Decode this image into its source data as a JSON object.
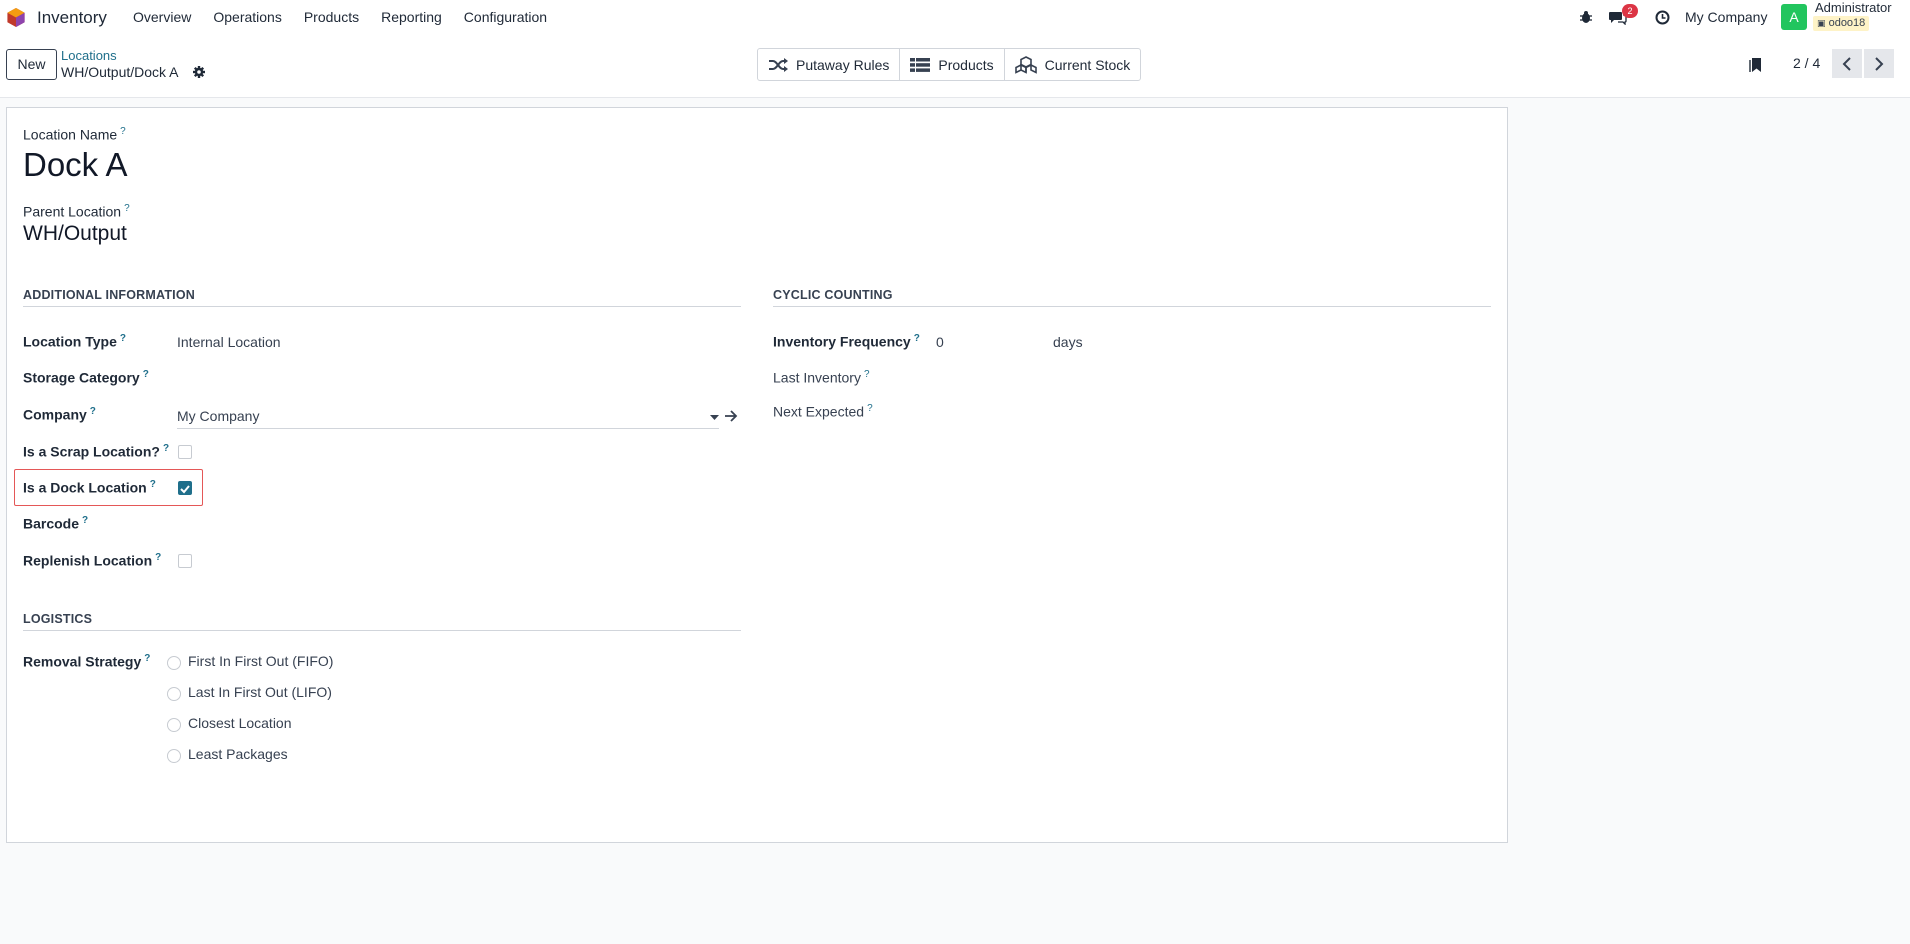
{
  "navbar": {
    "app_name": "Inventory",
    "menu": [
      "Overview",
      "Operations",
      "Products",
      "Reporting",
      "Configuration"
    ],
    "chat_badge": "2",
    "company": "My Company",
    "avatar_letter": "A",
    "user_name": "Administrator",
    "database": "odoo18",
    "icons": [
      "bug-icon",
      "chat-icon",
      "clock-icon"
    ]
  },
  "control": {
    "new_label": "New",
    "breadcrumb_parent": "Locations",
    "breadcrumb_current": "WH/Output/Dock A",
    "smart_buttons": [
      "Putaway Rules",
      "Products",
      "Current Stock"
    ],
    "pager": "2 / 4"
  },
  "form": {
    "name_label": "Location Name",
    "name_value": "Dock A",
    "parent_label": "Parent Location",
    "parent_value": "WH/Output",
    "additional_title": "ADDITIONAL INFORMATION",
    "location_type_label": "Location Type",
    "location_type_value": "Internal Location",
    "storage_category_label": "Storage Category",
    "company_label": "Company",
    "company_value": "My Company",
    "scrap_label": "Is a Scrap Location?",
    "scrap_checked": false,
    "dock_label": "Is a Dock Location",
    "dock_checked": true,
    "barcode_label": "Barcode",
    "replenish_label": "Replenish Location",
    "replenish_checked": false,
    "cyclic_title": "CYCLIC COUNTING",
    "frequency_label": "Inventory Frequency",
    "frequency_value": "0",
    "frequency_unit": "days",
    "last_inventory_label": "Last Inventory",
    "next_expected_label": "Next Expected",
    "logistics_title": "LOGISTICS",
    "removal_label": "Removal Strategy",
    "removal_options": [
      "First In First Out (FIFO)",
      "Last In First Out (LIFO)",
      "Closest Location",
      "Least Packages"
    ]
  },
  "colors": {
    "accent": "#1f6f8b",
    "badge": "#dc3545",
    "avatar": "#22c55e",
    "highlight": "#e45757"
  }
}
